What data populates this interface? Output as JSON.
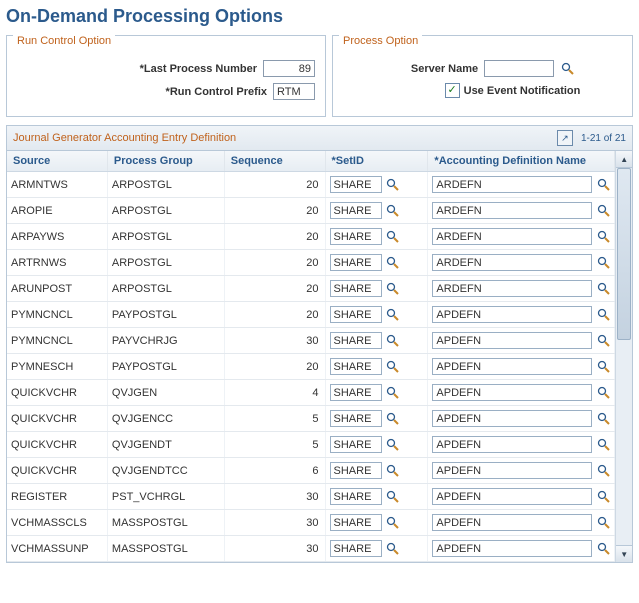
{
  "title": "On-Demand Processing Options",
  "panels": {
    "run_control": {
      "legend": "Run Control Option",
      "last_process_label": "*Last Process Number",
      "last_process_value": "89",
      "prefix_label": "*Run Control Prefix",
      "prefix_value": "RTM"
    },
    "process_option": {
      "legend": "Process Option",
      "server_label": "Server Name",
      "server_value": "",
      "notify_label": "Use Event Notification",
      "notify_checked": true
    }
  },
  "grid": {
    "title": "Journal Generator Accounting Entry Definition",
    "range_text": "1-21 of 21",
    "columns": {
      "source": "Source",
      "pgroup": "Process Group",
      "seq": "Sequence",
      "setid": "*SetID",
      "adn": "*Accounting Definition Name"
    },
    "rows": [
      {
        "source": "ARMNTWS",
        "pgroup": "ARPOSTGL",
        "seq": "20",
        "setid": "SHARE",
        "adn": "ARDEFN"
      },
      {
        "source": "AROPIE",
        "pgroup": "ARPOSTGL",
        "seq": "20",
        "setid": "SHARE",
        "adn": "ARDEFN"
      },
      {
        "source": "ARPAYWS",
        "pgroup": "ARPOSTGL",
        "seq": "20",
        "setid": "SHARE",
        "adn": "ARDEFN"
      },
      {
        "source": "ARTRNWS",
        "pgroup": "ARPOSTGL",
        "seq": "20",
        "setid": "SHARE",
        "adn": "ARDEFN"
      },
      {
        "source": "ARUNPOST",
        "pgroup": "ARPOSTGL",
        "seq": "20",
        "setid": "SHARE",
        "adn": "ARDEFN"
      },
      {
        "source": "PYMNCNCL",
        "pgroup": "PAYPOSTGL",
        "seq": "20",
        "setid": "SHARE",
        "adn": "APDEFN"
      },
      {
        "source": "PYMNCNCL",
        "pgroup": "PAYVCHRJG",
        "seq": "30",
        "setid": "SHARE",
        "adn": "APDEFN"
      },
      {
        "source": "PYMNESCH",
        "pgroup": "PAYPOSTGL",
        "seq": "20",
        "setid": "SHARE",
        "adn": "APDEFN"
      },
      {
        "source": "QUICKVCHR",
        "pgroup": "QVJGEN",
        "seq": "4",
        "setid": "SHARE",
        "adn": "APDEFN"
      },
      {
        "source": "QUICKVCHR",
        "pgroup": "QVJGENCC",
        "seq": "5",
        "setid": "SHARE",
        "adn": "APDEFN"
      },
      {
        "source": "QUICKVCHR",
        "pgroup": "QVJGENDT",
        "seq": "5",
        "setid": "SHARE",
        "adn": "APDEFN"
      },
      {
        "source": "QUICKVCHR",
        "pgroup": "QVJGENDTCC",
        "seq": "6",
        "setid": "SHARE",
        "adn": "APDEFN"
      },
      {
        "source": "REGISTER",
        "pgroup": "PST_VCHRGL",
        "seq": "30",
        "setid": "SHARE",
        "adn": "APDEFN"
      },
      {
        "source": "VCHMASSCLS",
        "pgroup": "MASSPOSTGL",
        "seq": "30",
        "setid": "SHARE",
        "adn": "APDEFN"
      },
      {
        "source": "VCHMASSUNP",
        "pgroup": "MASSPOSTGL",
        "seq": "30",
        "setid": "SHARE",
        "adn": "APDEFN"
      }
    ]
  },
  "icons": {
    "check": "✓",
    "up": "▲",
    "down": "▼",
    "popout": "↗"
  }
}
